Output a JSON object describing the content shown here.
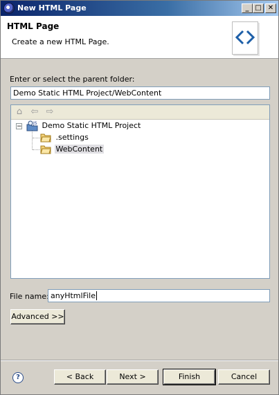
{
  "window": {
    "title": "New HTML Page",
    "minimize_label": "_",
    "maximize_label": "□",
    "close_label": "✕"
  },
  "header": {
    "title": "HTML Page",
    "description": "Create a new HTML Page."
  },
  "folder_section": {
    "label": "Enter or select the parent folder:",
    "value": "Demo Static HTML Project/WebContent"
  },
  "tree": {
    "toolbar": {
      "home_icon": "home-icon",
      "back_icon": "back-arrow-icon",
      "forward_icon": "forward-arrow-icon"
    },
    "root": {
      "label": "Demo Static HTML Project",
      "expander": "−",
      "children": [
        {
          "label": ".settings"
        },
        {
          "label": "WebContent",
          "selected": true
        }
      ]
    }
  },
  "file_name": {
    "label": "File name:",
    "value": "anyHtmlFile"
  },
  "advanced_button": "Advanced >>",
  "buttons": {
    "back": "< Back",
    "next": "Next >",
    "finish": "Finish",
    "cancel": "Cancel",
    "help": "?"
  }
}
